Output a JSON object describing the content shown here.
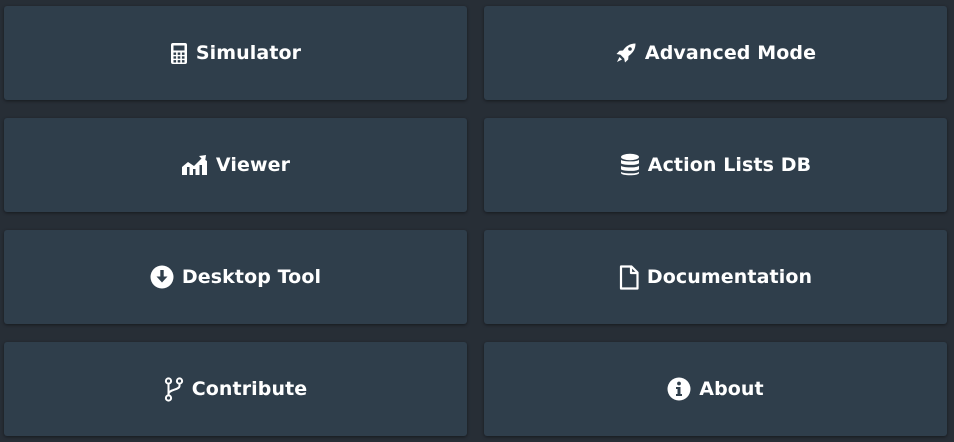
{
  "menu": {
    "tiles": [
      {
        "label": "Simulator",
        "icon": "calculator-icon"
      },
      {
        "label": "Advanced Mode",
        "icon": "rocket-icon"
      },
      {
        "label": "Viewer",
        "icon": "chart-area-icon"
      },
      {
        "label": "Action Lists DB",
        "icon": "database-icon"
      },
      {
        "label": "Desktop Tool",
        "icon": "download-circle-icon"
      },
      {
        "label": "Documentation",
        "icon": "file-icon"
      },
      {
        "label": "Contribute",
        "icon": "code-branch-icon"
      },
      {
        "label": "About",
        "icon": "info-circle-icon"
      }
    ]
  },
  "colors": {
    "background": "#272e36",
    "tile": "#2f3e4b",
    "text": "#ffffff"
  }
}
